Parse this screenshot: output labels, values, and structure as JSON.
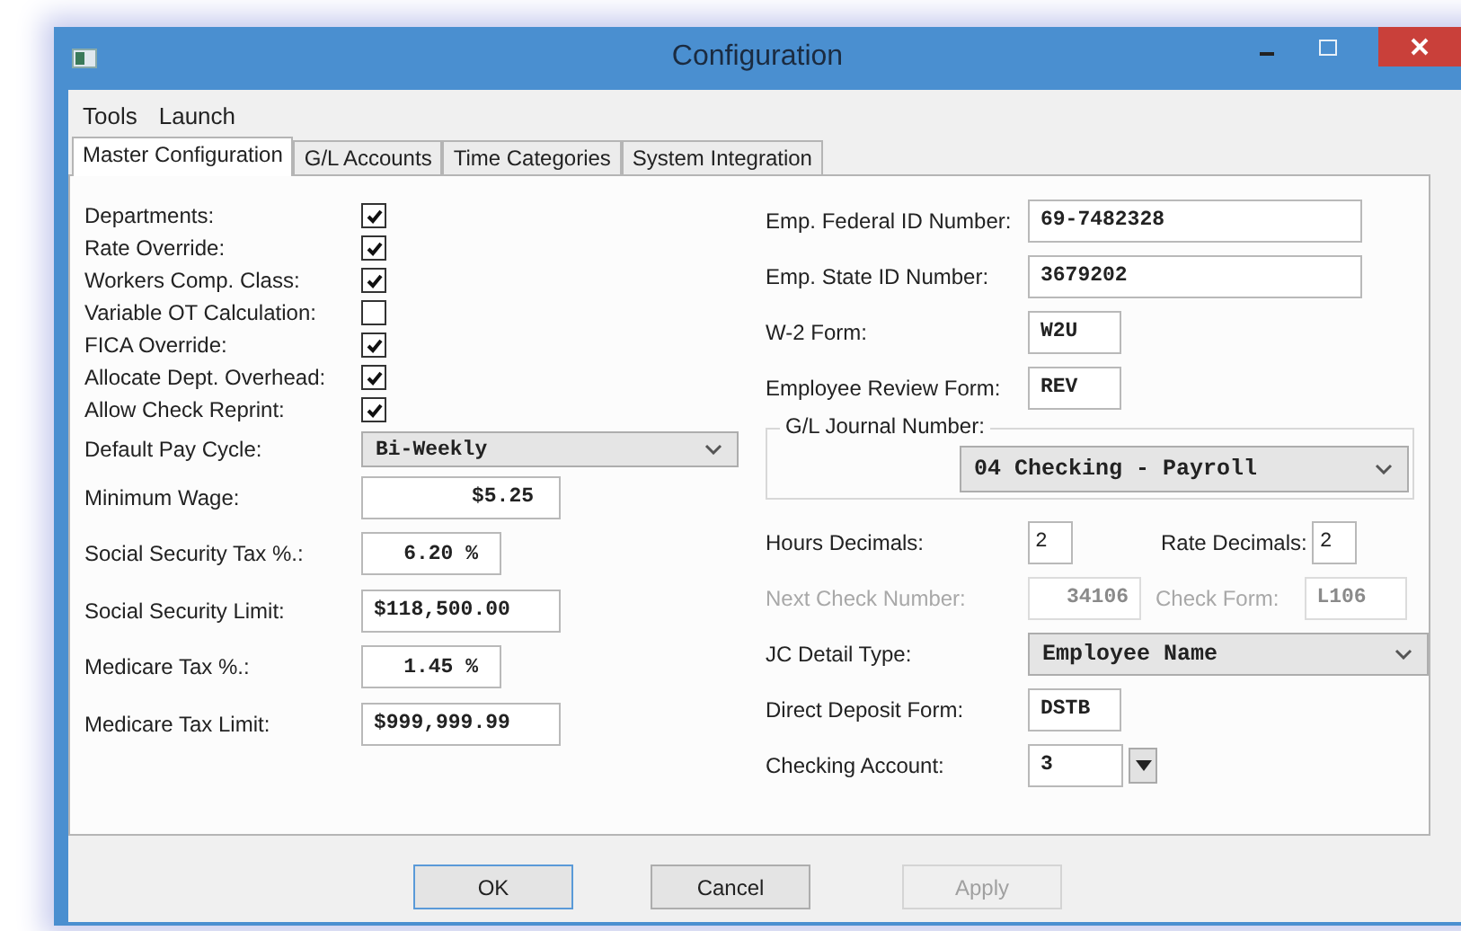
{
  "window": {
    "title": "Configuration"
  },
  "menu": [
    {
      "label": "Tools"
    },
    {
      "label": "Launch"
    }
  ],
  "tabs": [
    {
      "label": "Master Configuration",
      "selected": true
    },
    {
      "label": "G/L Accounts",
      "selected": false
    },
    {
      "label": "Time Categories",
      "selected": false
    },
    {
      "label": "System Integration",
      "selected": false
    }
  ],
  "left": {
    "checkboxes": [
      {
        "label": "Departments:",
        "checked": true
      },
      {
        "label": "Rate Override:",
        "checked": true
      },
      {
        "label": "Workers Comp. Class:",
        "checked": true
      },
      {
        "label": "Variable OT Calculation:",
        "checked": false
      },
      {
        "label": "FICA Override:",
        "checked": true
      },
      {
        "label": "Allocate Dept. Overhead:",
        "checked": true
      },
      {
        "label": "Allow Check Reprint:",
        "checked": true
      }
    ],
    "pay_cycle": {
      "label": "Default Pay Cycle:",
      "value": "Bi-Weekly"
    },
    "fields": [
      {
        "label": "Minimum Wage:",
        "value": "$5.25",
        "kind": "amount"
      },
      {
        "label": "Social Security Tax %.:",
        "value": "6.20 %",
        "kind": "percent"
      },
      {
        "label": "Social Security Limit:",
        "value": "$118,500.00",
        "kind": "limit"
      },
      {
        "label": "Medicare Tax %.:",
        "value": "1.45 %",
        "kind": "percent"
      },
      {
        "label": "Medicare Tax Limit:",
        "value": "$999,999.99",
        "kind": "limit"
      }
    ]
  },
  "right": {
    "federal_id": {
      "label": "Emp. Federal ID Number:",
      "value": "69-7482328"
    },
    "state_id": {
      "label": "Emp. State ID Number:",
      "value": "3679202"
    },
    "w2_form": {
      "label": "W-2 Form:",
      "value": "W2U"
    },
    "review_form": {
      "label": "Employee Review Form:",
      "value": "REV"
    },
    "gl_journal": {
      "legend": "G/L Journal Number:",
      "value": "04 Checking - Payroll"
    },
    "hours_decimals": {
      "label": "Hours Decimals:",
      "value": "2"
    },
    "rate_decimals": {
      "label": "Rate Decimals:",
      "value": "2"
    },
    "next_check": {
      "label": "Next Check Number:",
      "value": "34106",
      "disabled": true
    },
    "check_form": {
      "label": "Check Form:",
      "value": "L106",
      "disabled": true
    },
    "jc_detail": {
      "label": "JC Detail Type:",
      "value": "Employee Name"
    },
    "direct_deposit": {
      "label": "Direct Deposit Form:",
      "value": "DSTB"
    },
    "checking_account": {
      "label": "Checking Account:",
      "value": "3"
    }
  },
  "buttons": [
    {
      "label": "OK",
      "disabled": false
    },
    {
      "label": "Cancel",
      "disabled": false
    },
    {
      "label": "Apply",
      "disabled": true
    }
  ]
}
